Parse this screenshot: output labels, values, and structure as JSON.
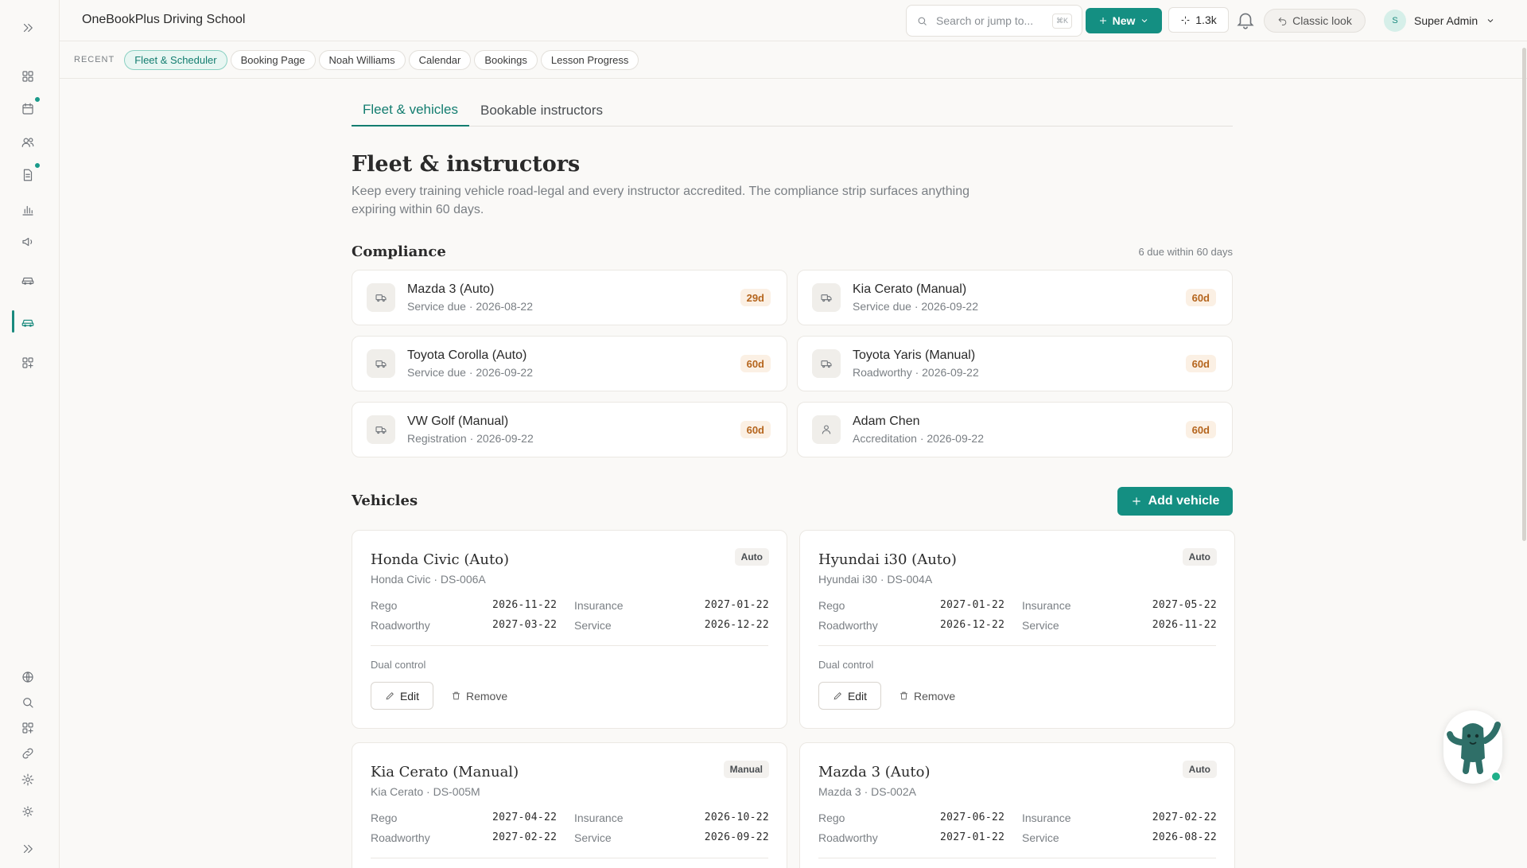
{
  "app": {
    "title": "OneBookPlus Driving School"
  },
  "header": {
    "search_placeholder": "Search or jump to...",
    "search_shortcut": "⌘K",
    "new_label": "New",
    "credits": "1.3k",
    "classic_label": "Classic look",
    "user_initial": "S",
    "user_name": "Super Admin"
  },
  "sidebar": {
    "icons": [
      "expand-icon",
      "dashboard-icon",
      "calendar-icon",
      "users-icon",
      "document-icon",
      "chart-icon",
      "megaphone-icon",
      "car-icon",
      "fleet-icon",
      "apps-add-icon",
      "globe-icon",
      "search-icon",
      "apps-icon",
      "link-icon",
      "settings-icon",
      "theme-icon",
      "collapse-icon"
    ]
  },
  "recent": {
    "label": "RECENT",
    "items": [
      "Fleet & Scheduler",
      "Booking Page",
      "Noah Williams",
      "Calendar",
      "Bookings",
      "Lesson Progress"
    ]
  },
  "tabs": [
    "Fleet & vehicles",
    "Bookable instructors"
  ],
  "page": {
    "title": "Fleet & instructors",
    "description": "Keep every training vehicle road-legal and every instructor accredited. The compliance strip surfaces anything expiring within 60 days."
  },
  "compliance": {
    "title": "Compliance",
    "meta": "6 due within 60 days",
    "items": [
      {
        "name": "Mazda 3 (Auto)",
        "sub": "Service due · 2026-08-22",
        "badge": "29d",
        "icon": "truck-icon"
      },
      {
        "name": "Kia Cerato (Manual)",
        "sub": "Service due · 2026-09-22",
        "badge": "60d",
        "icon": "truck-icon"
      },
      {
        "name": "Toyota Corolla (Auto)",
        "sub": "Service due · 2026-09-22",
        "badge": "60d",
        "icon": "truck-icon"
      },
      {
        "name": "Toyota Yaris (Manual)",
        "sub": "Roadworthy · 2026-09-22",
        "badge": "60d",
        "icon": "truck-icon"
      },
      {
        "name": "VW Golf (Manual)",
        "sub": "Registration · 2026-09-22",
        "badge": "60d",
        "icon": "truck-icon"
      },
      {
        "name": "Adam Chen",
        "sub": "Accreditation · 2026-09-22",
        "badge": "60d",
        "icon": "person-icon"
      }
    ]
  },
  "vehicles": {
    "title": "Vehicles",
    "add_label": "Add vehicle",
    "labels": {
      "rego": "Rego",
      "insurance": "Insurance",
      "roadworthy": "Roadworthy",
      "service": "Service"
    },
    "edit_label": "Edit",
    "remove_label": "Remove",
    "items": [
      {
        "name": "Honda Civic (Auto)",
        "sub": "Honda Civic · DS-006A",
        "badge": "Auto",
        "rego": "2026-11-22",
        "insurance": "2027-01-22",
        "roadworthy": "2027-03-22",
        "service": "2026-12-22",
        "feature": "Dual control"
      },
      {
        "name": "Hyundai i30 (Auto)",
        "sub": "Hyundai i30 · DS-004A",
        "badge": "Auto",
        "rego": "2027-01-22",
        "insurance": "2027-05-22",
        "roadworthy": "2026-12-22",
        "service": "2026-11-22",
        "feature": "Dual control"
      },
      {
        "name": "Kia Cerato (Manual)",
        "sub": "Kia Cerato · DS-005M",
        "badge": "Manual",
        "rego": "2027-04-22",
        "insurance": "2026-10-22",
        "roadworthy": "2027-02-22",
        "service": "2026-09-22",
        "feature": ""
      },
      {
        "name": "Mazda 3 (Auto)",
        "sub": "Mazda 3 · DS-002A",
        "badge": "Auto",
        "rego": "2027-06-22",
        "insurance": "2027-02-22",
        "roadworthy": "2027-01-22",
        "service": "2026-08-22",
        "feature": ""
      }
    ]
  },
  "colors": {
    "accent": "#148f82",
    "badge_warn_bg": "#fbf0e4",
    "badge_warn_text": "#b5651d"
  }
}
